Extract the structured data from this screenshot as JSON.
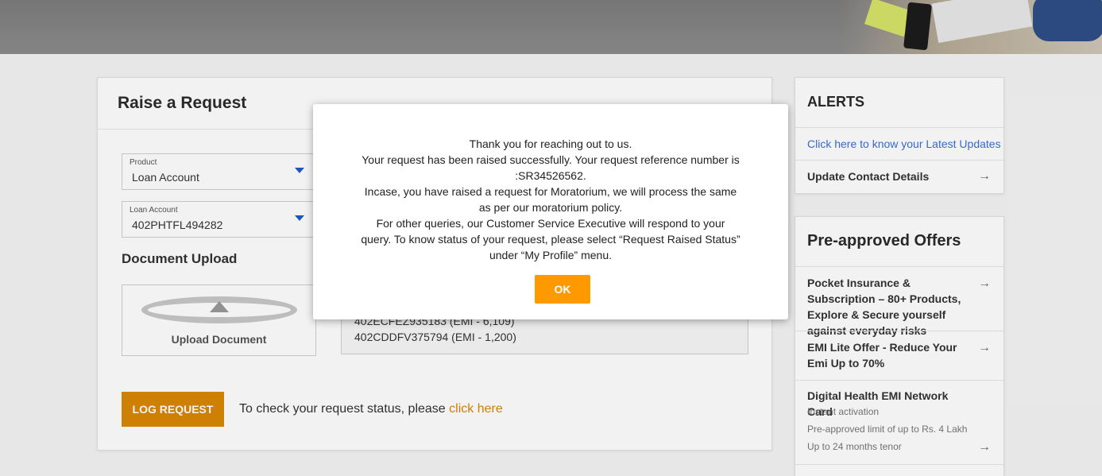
{
  "main": {
    "title": "Raise a Request",
    "product": {
      "label": "Product",
      "value": "Loan Account"
    },
    "loan_account": {
      "label": "Loan Account",
      "value": "402PHTFL494282"
    },
    "document_upload_title": "Document Upload",
    "upload_label": "Upload Document",
    "loan_list": [
      "402ECFEZ935183 (EMI - 6,109)",
      "402CDDFV375794 (EMI - 1,200)"
    ],
    "log_button": "LOG REQUEST",
    "status_text": "To check your request status, please ",
    "status_link": "click here"
  },
  "alerts": {
    "title": "ALERTS",
    "latest_updates_link": "Click here to know your Latest Updates",
    "update_contact": "Update Contact Details"
  },
  "offers": {
    "title": "Pre-approved Offers",
    "items": [
      {
        "title": "Pocket Insurance & Subscription – 80+ Products, Explore & Secure yourself against everyday risks"
      },
      {
        "title": "EMI Lite Offer - Reduce Your Emi Up to 70%"
      },
      {
        "title": "Digital Health EMI Network Card",
        "sub1": "Instant activation",
        "sub2": "Pre-approved limit of up to Rs. 4 Lakh",
        "sub3": "Up to 24 months tenor"
      }
    ]
  },
  "modal": {
    "line1": "Thank you for reaching out to us.",
    "line2": "Your request has been raised successfully. Your request reference number is :SR34526562.",
    "line3": "Incase, you have raised a request for Moratorium, we will process the same as per our moratorium policy.",
    "line4": "For other queries, our Customer Service Executive will respond to your query. To know status of your request, please select “Request Raised Status” under “My Profile” menu.",
    "ok_label": "OK"
  }
}
